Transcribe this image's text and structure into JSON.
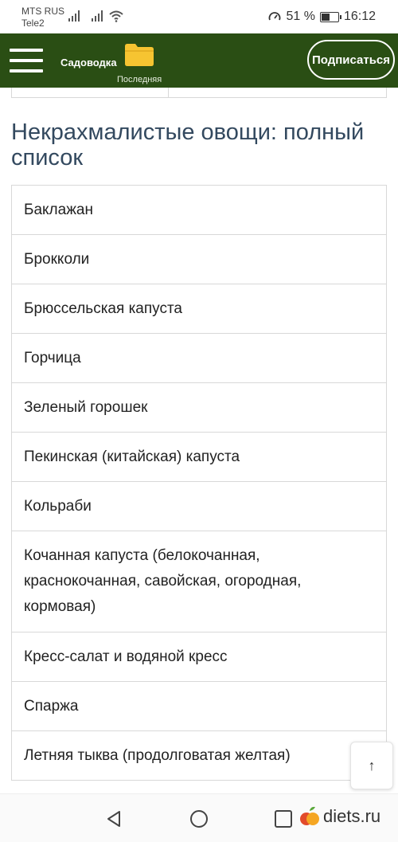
{
  "status_bar": {
    "carrier_primary": "MTS RUS",
    "carrier_secondary": "Tele2",
    "battery_percent": "51 %",
    "battery_level": 0.51,
    "time": "16:12"
  },
  "app_bar": {
    "site_title": "Садоводка",
    "folder_label": "Последняя",
    "subscribe_label": "Подписаться",
    "background_color": "#2a4e14",
    "folder_color": "#f6c431"
  },
  "article": {
    "heading": "Некрахмалистые овощи: полный список",
    "heading_color": "#33495f",
    "vegetables": [
      "Баклажан",
      "Брокколи",
      "Брюссельская капуста",
      "Горчица",
      "Зеленый горошек",
      "Пекинская (китайская) капуста",
      "Кольраби",
      "Кочанная капуста (белокочанная, краснокочанная, савойская, огородная, кормовая)",
      "Кресс-салат и водяной кресс",
      "Спаржа",
      "Летняя тыква (продолговатая желтая)"
    ]
  },
  "scroll_top": {
    "icon": "arrow-up-icon",
    "glyph": "↑"
  },
  "nav_bar": {
    "back_icon": "triangle-back-icon",
    "home_icon": "circle-home-icon",
    "recents_icon": "square-recents-icon",
    "watermark_text": "diets.ru"
  }
}
